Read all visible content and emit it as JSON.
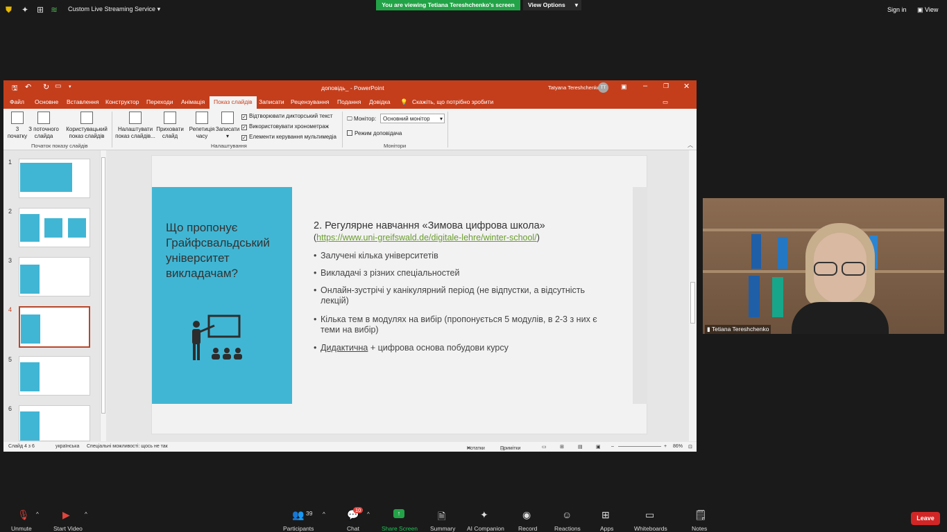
{
  "zoom": {
    "stream_service": "Custom Live Streaming Service",
    "viewing_banner": "You are viewing Tetiana Tereshchenko's screen",
    "view_options": "View Options",
    "sign_in": "Sign in",
    "view": "View",
    "participant_name": "Tetiana Tereshchenko",
    "toolbar": {
      "unmute": "Unmute",
      "start_video": "Start Video",
      "participants": "Participants",
      "participants_count": "39",
      "chat": "Chat",
      "chat_badge": "10",
      "share_screen": "Share Screen",
      "summary": "Summary",
      "ai_companion": "AI Companion",
      "record": "Record",
      "reactions": "Reactions",
      "apps": "Apps",
      "whiteboards": "Whiteboards",
      "notes": "Notes",
      "leave": "Leave"
    },
    "colors": {
      "banner_green": "#23a347",
      "leave_red": "#d22626",
      "share_green": "#23a347"
    }
  },
  "ppt": {
    "doc_title": "доповідь_  -  PowerPoint",
    "user": "Tatyana Tereshchenko",
    "user_initials": "TT",
    "tabs": [
      "Файл",
      "Основне",
      "Вставлення",
      "Конструктор",
      "Переходи",
      "Анімація",
      "Показ слайдів",
      "Записати",
      "Рецензування",
      "Подання",
      "Довідка"
    ],
    "tell_me": "Скажіть, що потрібно зробити",
    "ribbon": {
      "from_start": [
        "3",
        "початку"
      ],
      "from_current": [
        "З поточного",
        "слайда"
      ],
      "custom_show": [
        "Користувацький",
        "показ слайдів"
      ],
      "group_start": "Початок показу слайдів",
      "setup_show": [
        "Налаштувати",
        "показ слайдів..."
      ],
      "hide_slide": [
        "Приховати",
        "слайд"
      ],
      "rehearse": [
        "Репетиція",
        "часу"
      ],
      "record": [
        "Записати",
        ""
      ],
      "chk_narration": "Відтворювати дикторський текст",
      "chk_timings": "Використовувати хронометраж",
      "chk_media": "Елементи керування мультимедіа",
      "group_setup": "Налаштування",
      "monitor_label": "Монітор:",
      "monitor_value": "Основний монітор",
      "presenter_view": "Режим доповідача",
      "group_monitors": "Монітори"
    },
    "thumb_numbers": [
      "1",
      "2",
      "3",
      "4",
      "5",
      "6"
    ],
    "slide": {
      "left_title": "Що пропонує Грайфсвальдський університет викладачам?",
      "heading": "2. Регулярне навчання «Зимова цифрова школа»",
      "link_open": "(",
      "link": "https://www.uni-greifswald.de/digitale-lehre/winter-school/",
      "link_close": ")",
      "bullets": [
        "Залучені кілька університетів",
        "Викладачі з різних спеціальностей",
        "Онлайн-зустрічі у канікулярний період (не відпустки, а відсутність лекцій)",
        "Кілька тем в модулях на вибір (пропонується 5 модулів, в 2-3 з них є теми на вибір)"
      ],
      "last_underlined": "Дидактична",
      "last_rest": " + цифрова основа побудови курсу"
    },
    "status": {
      "slide_count": "Слайд 4 з 6",
      "language": "українська",
      "accessibility": "Спеціальні можливості: щось не так",
      "notes": "Нотатки",
      "comments": "Примітки",
      "zoom": "86%"
    },
    "colors": {
      "ribbon_red": "#c43e1c",
      "slide_blue": "#41b6d4",
      "link_green": "#6a9c2e"
    }
  }
}
